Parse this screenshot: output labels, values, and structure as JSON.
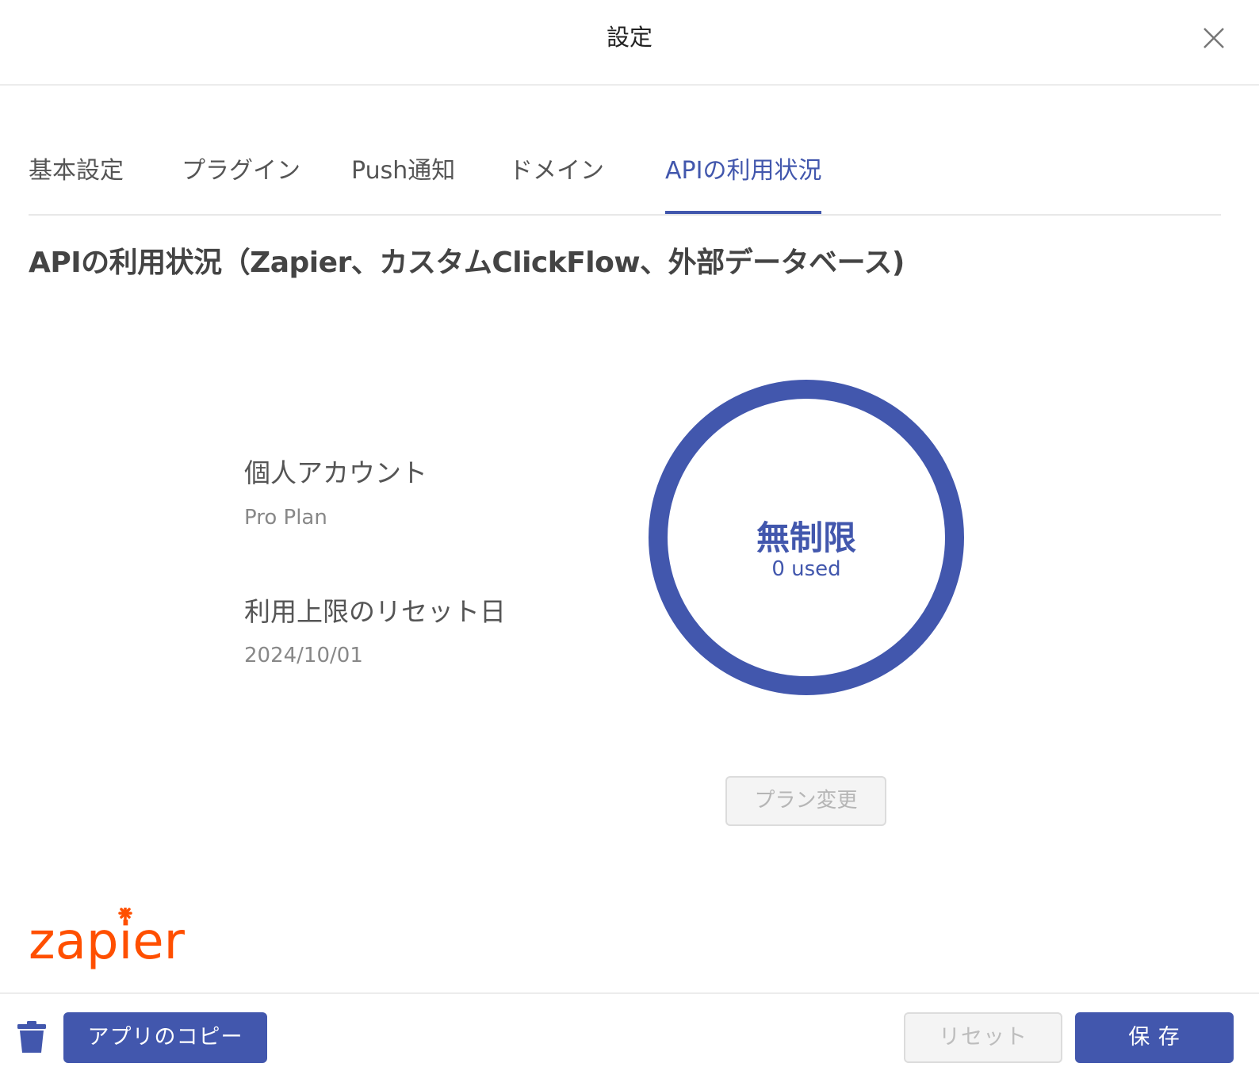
{
  "header": {
    "title": "設定"
  },
  "tabs": [
    {
      "label": "基本設定"
    },
    {
      "label": "プラグイン"
    },
    {
      "label": "Push通知"
    },
    {
      "label": "ドメイン"
    },
    {
      "label": "APIの利用状況",
      "active": true
    }
  ],
  "section": {
    "title": "APIの利用状況（Zapier、カスタムClickFlow、外部データベース)"
  },
  "account": {
    "label": "個人アカウント",
    "plan": "Pro Plan",
    "reset_label": "利用上限のリセット日",
    "reset_date": "2024/10/01"
  },
  "usage": {
    "limit_text": "無制限",
    "used_text": "0 used",
    "accent_color": "#4257ad"
  },
  "plan_button": {
    "label": "プラン変更"
  },
  "logo": {
    "text": "zapier",
    "color": "#ff4f00"
  },
  "footer": {
    "copy_label": "アプリのコピー",
    "reset_label": "リセット",
    "save_label": "保 存"
  },
  "icons": {
    "close": "close-icon",
    "trash": "trash-icon"
  }
}
